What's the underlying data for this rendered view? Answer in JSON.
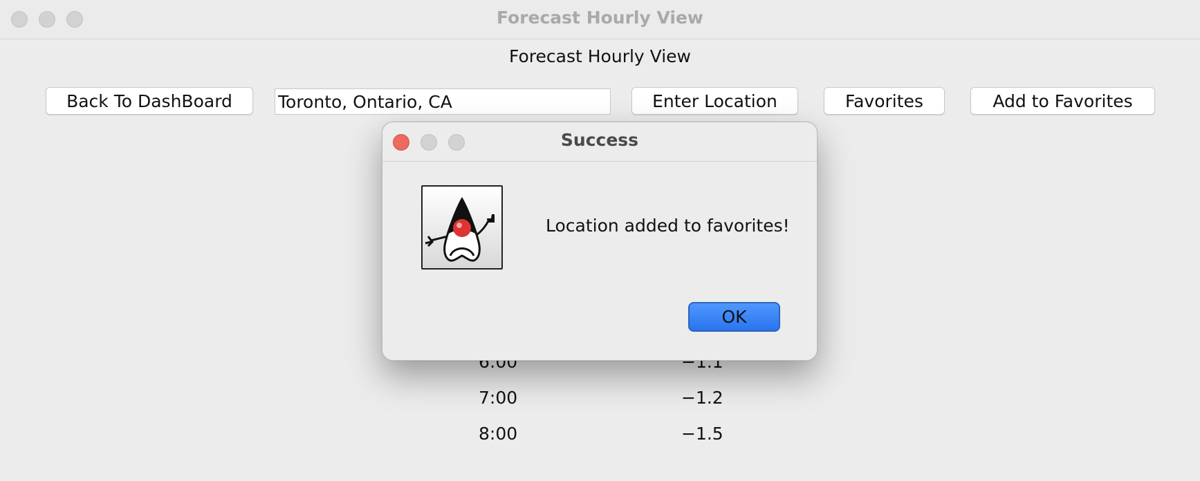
{
  "window": {
    "title": "Forecast Hourly View",
    "controls": [
      "close",
      "minimize",
      "zoom"
    ]
  },
  "page": {
    "heading": "Forecast Hourly View"
  },
  "toolbar": {
    "back_label": "Back To DashBoard",
    "location_value": "Toronto, Ontario, CA",
    "enter_location_label": "Enter Location",
    "favorites_label": "Favorites",
    "add_favorites_label": "Add to Favorites"
  },
  "forecast": {
    "rows": [
      {
        "hour": "6:00",
        "temp": "−1.1"
      },
      {
        "hour": "7:00",
        "temp": "−1.2"
      },
      {
        "hour": "8:00",
        "temp": "−1.5"
      }
    ]
  },
  "dialog": {
    "title": "Success",
    "message": "Location added to favorites!",
    "ok_label": "OK",
    "icon": "java-duke-icon",
    "close_color": "#ed6a5e"
  },
  "colors": {
    "accent": "#2a74ee",
    "window_bg": "#ececec"
  }
}
